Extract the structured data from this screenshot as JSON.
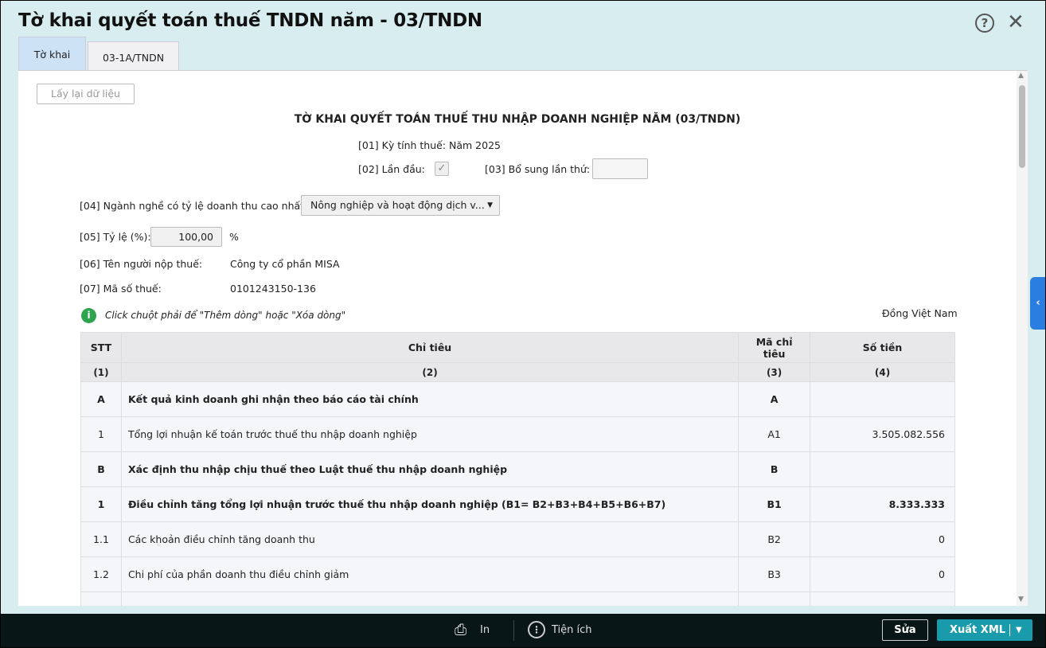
{
  "window": {
    "title": "Tờ khai quyết toán thuế TNDN năm - 03/TNDN"
  },
  "tabs": [
    {
      "label": "Tờ khai",
      "active": true
    },
    {
      "label": "03-1A/TNDN",
      "active": false
    }
  ],
  "toolbar": {
    "reload_label": "Lấy lại dữ liệu"
  },
  "form": {
    "heading": "TỜ KHAI QUYẾT TOÁN THUẾ THU NHẬP DOANH NGHIỆP NĂM (03/TNDN)",
    "f01": "[01] Kỳ tính thuế: Năm 2025",
    "f02_label": "[02] Lần đầu:",
    "f02_checked": true,
    "f03_label": "[03] Bổ sung lần thứ:",
    "f03_value": "",
    "f04_label": "[04] Ngành nghề có tỷ lệ doanh thu cao nhất:",
    "f04_value": "Nông nghiệp và hoạt động dịch v...",
    "f05_label": "[05] Tỷ lệ (%):",
    "f05_value": "100,00",
    "f05_unit": "%",
    "f06_label": "[06] Tên người nộp thuế:",
    "f06_value": "Công ty cổ phần MISA",
    "f07_label": "[07] Mã số thuế:",
    "f07_value": "0101243150-136",
    "hint": "Click chuột phải để \"Thêm dòng\" hoặc \"Xóa dòng\"",
    "currency": "Đồng Việt Nam"
  },
  "table": {
    "headers": [
      "STT",
      "Chỉ tiêu",
      "Mã chỉ tiêu",
      "Số tiền"
    ],
    "subheaders": [
      "(1)",
      "(2)",
      "(3)",
      "(4)"
    ],
    "rows": [
      {
        "stt": "A",
        "name": "Kết quả kinh doanh ghi nhận theo báo cáo tài chính",
        "code": "A",
        "amount": ""
      },
      {
        "stt": "1",
        "name": "Tổng lợi nhuận kế toán trước thuế thu nhập doanh nghiệp",
        "code": "A1",
        "amount": "3.505.082.556"
      },
      {
        "stt": "B",
        "name": "Xác định thu nhập chịu thuế theo Luật thuế thu nhập doanh nghiệp",
        "code": "B",
        "amount": ""
      },
      {
        "stt": "1",
        "name": "Điều chỉnh tăng tổng lợi nhuận trước thuế thu nhập doanh nghiệp (B1= B2+B3+B4+B5+B6+B7)",
        "code": "B1",
        "amount": "8.333.333"
      },
      {
        "stt": "1.1",
        "name": "Các khoản điều chỉnh tăng doanh thu",
        "code": "B2",
        "amount": "0"
      },
      {
        "stt": "1.2",
        "name": "Chi phí của phần doanh thu điều chỉnh giảm",
        "code": "B3",
        "amount": "0"
      }
    ]
  },
  "footer": {
    "print": "In",
    "utilities": "Tiện ích",
    "edit": "Sửa",
    "export": "Xuất XML"
  }
}
